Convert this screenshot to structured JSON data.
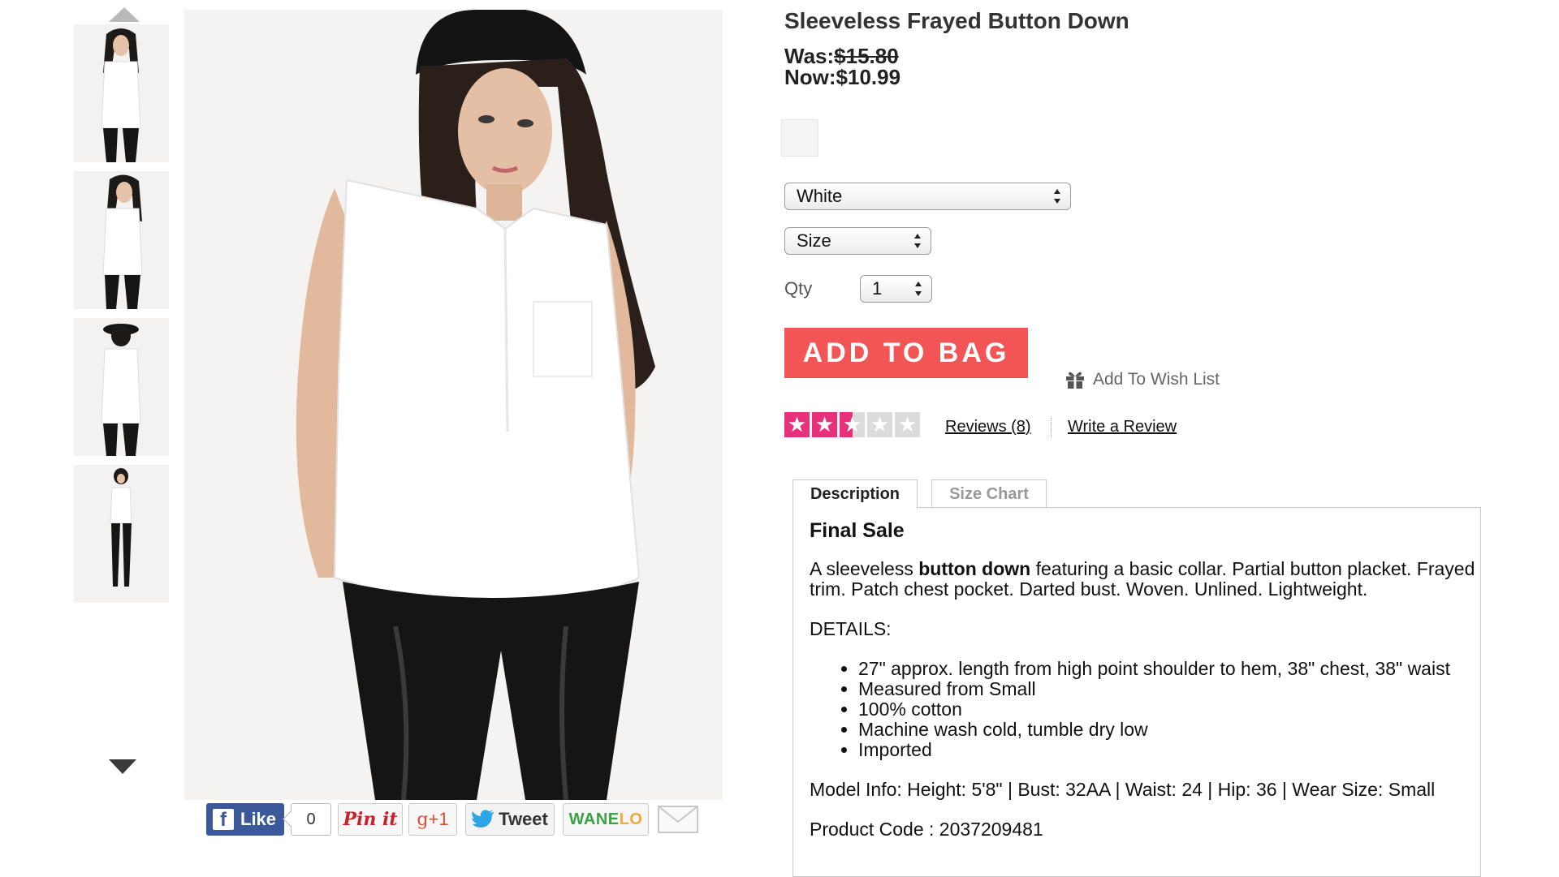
{
  "gallery": {
    "up_arrow_icon": "triangle-up",
    "down_arrow_icon": "triangle-down",
    "thumbnails": [
      "front-view",
      "angled-front-view",
      "back-view",
      "full-body-view"
    ]
  },
  "social": {
    "like_label": "Like",
    "like_count": "0",
    "pin_label": "Pin it",
    "gplus_label": "+1",
    "tweet_label": "Tweet",
    "wanelo_label_a": "WANE",
    "wanelo_label_b": "LO",
    "email_icon": "envelope"
  },
  "product": {
    "title": "Sleeveless Frayed Button Down",
    "was_label": "Was:",
    "was_price": "$15.80",
    "now_label": "Now:",
    "now_price": "$10.99",
    "swatch_color": "#f4f4f6",
    "color_select": "White",
    "size_select": "Size",
    "qty_label": "Qty",
    "qty_select": "1",
    "add_to_bag": "ADD TO BAG",
    "wishlist": "Add To Wish List",
    "rating": 2.5,
    "rating_max": 5,
    "reviews_link": "Reviews (8)",
    "write_review": "Write a Review"
  },
  "tabs": {
    "description": "Description",
    "size_chart": "Size Chart"
  },
  "description": {
    "heading": "Final Sale",
    "intro_a": "A sleeveless ",
    "intro_bold": "button down",
    "intro_b": " featuring a basic collar. Partial button placket. Frayed trim. Patch chest pocket. Darted bust. Woven. Unlined. Lightweight.",
    "details_label": "DETAILS:",
    "details": [
      "27\" approx. length from high point shoulder to hem, 38\" chest, 38\" waist",
      "Measured from Small",
      "100% cotton",
      "Machine wash cold, tumble dry low",
      "Imported"
    ],
    "model_info": "Model Info: Height: 5'8\" | Bust: 32AA | Waist: 24 | Hip: 36 | Wear Size: Small",
    "product_code": "Product Code : 2037209481"
  },
  "colors": {
    "accent_red": "#f25555",
    "star_pink": "#e8307b",
    "facebook_blue": "#3b5998"
  }
}
